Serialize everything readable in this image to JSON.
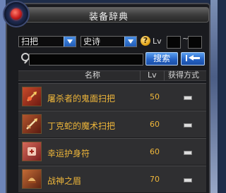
{
  "window": {
    "title": "装备辞典"
  },
  "filters": {
    "category": "扫把",
    "rarity": "史诗",
    "help_label": "?",
    "level_label": "Lv",
    "level_sep": "~"
  },
  "search": {
    "value": "",
    "placeholder": "",
    "button_label": "搜索"
  },
  "table": {
    "headers": {
      "name": "名称",
      "level": "Lv",
      "acquisition": "获得方式"
    },
    "rows": [
      {
        "name": "屠杀者的鬼面扫把",
        "level": "50",
        "icon": "broom-icon"
      },
      {
        "name": "丁克蛇的魔术扫把",
        "level": "60",
        "icon": "broom-icon"
      },
      {
        "name": "幸运护身符",
        "level": "60",
        "icon": "amulet-icon"
      },
      {
        "name": "战神之眉",
        "level": "70",
        "icon": "helmet-icon"
      }
    ]
  },
  "colors": {
    "item_name": "#f0b73a",
    "button": "#2563c6",
    "panel": "#1a1b1f"
  }
}
